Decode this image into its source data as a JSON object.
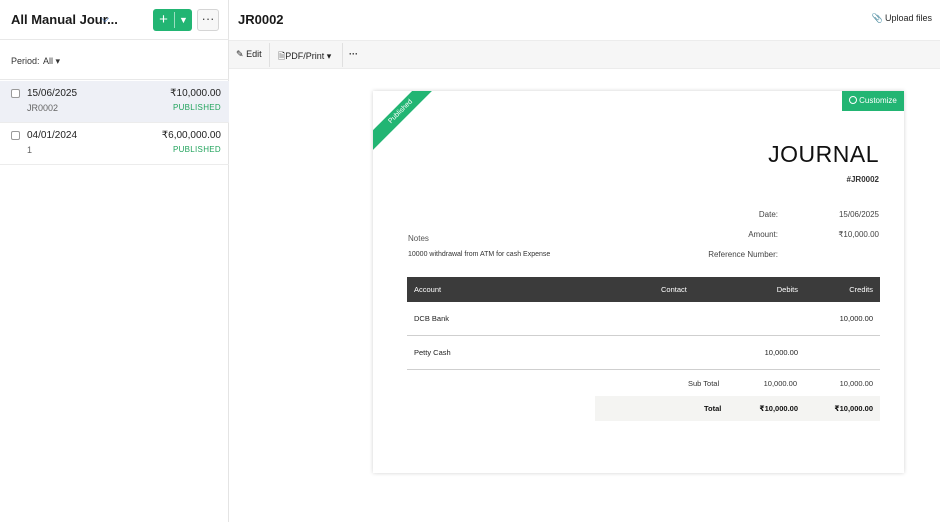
{
  "sidebar": {
    "view_title": "All Manual Jour...",
    "new_button": "+",
    "more_button": "···",
    "period_label": "Period:",
    "period_value": "All ▾",
    "rows": [
      {
        "date": "15/06/2025",
        "ref": "JR0002",
        "amount": "₹10,000.00",
        "status": "PUBLISHED"
      },
      {
        "date": "04/01/2024",
        "ref": "1",
        "amount": "₹6,00,000.00",
        "status": "PUBLISHED"
      }
    ]
  },
  "header": {
    "title": "JR0002",
    "upload_label": "Upload files"
  },
  "toolbar": {
    "edit_label": "Edit",
    "pdf_label": "PDF/Print",
    "more_label": "···"
  },
  "document": {
    "ribbon": "Published",
    "customize_label": "Customize",
    "title": "JOURNAL",
    "number": "#JR0002",
    "date_label": "Date:",
    "date_value": "15/06/2025",
    "amount_label": "Amount:",
    "amount_value": "₹10,000.00",
    "reference_label": "Reference Number:",
    "reference_value": "",
    "notes_label": "Notes",
    "notes_text": "10000 withdrawal from ATM for cash Expense",
    "table": {
      "headers": {
        "account": "Account",
        "contact": "Contact",
        "debits": "Debits",
        "credits": "Credits"
      },
      "rows": [
        {
          "account": "DCB Bank",
          "contact": "",
          "debits": "",
          "credits": "10,000.00"
        },
        {
          "account": "Petty Cash",
          "contact": "",
          "debits": "10,000.00",
          "credits": ""
        }
      ]
    },
    "subtotal": {
      "label": "Sub Total",
      "debits": "10,000.00",
      "credits": "10,000.00"
    },
    "total": {
      "label": "Total",
      "debits": "₹10,000.00",
      "credits": "₹10,000.00"
    }
  },
  "colors": {
    "accent_green": "#22b573",
    "status_green": "#22a45d",
    "link_blue": "#2c6ecb",
    "table_header": "#3b3b3b"
  }
}
